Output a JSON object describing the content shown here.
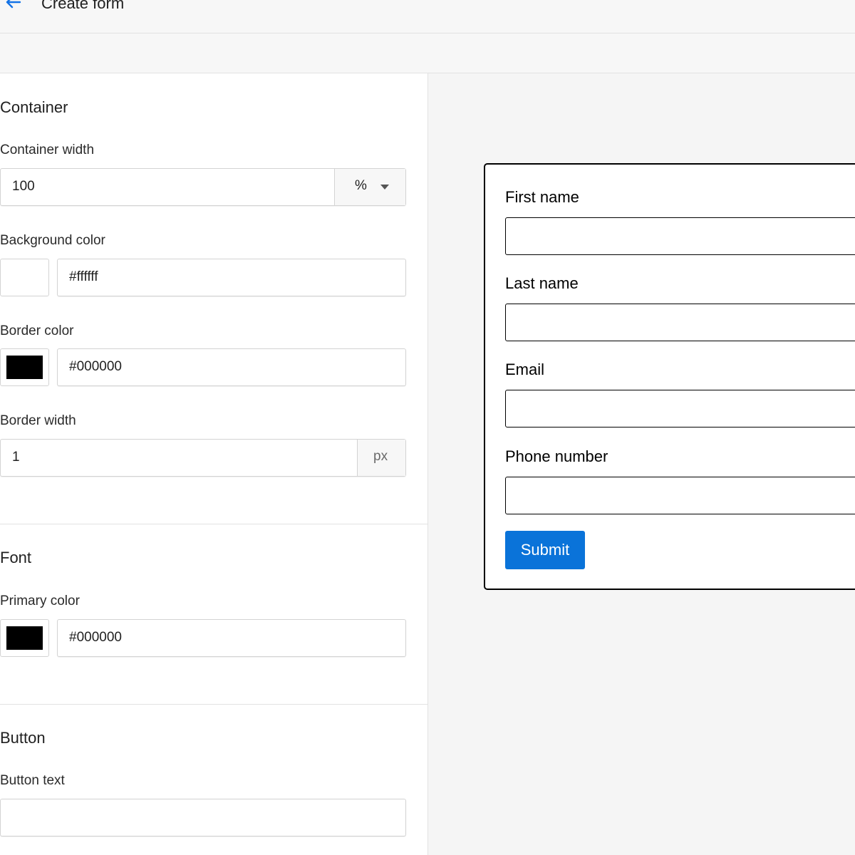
{
  "header": {
    "title": "Create form",
    "back_icon": "arrow-left-icon"
  },
  "container": {
    "title": "Container",
    "width_label": "Container width",
    "width_value": "100",
    "width_unit": "%",
    "bg_label": "Background color",
    "bg_value": "#ffffff",
    "bg_swatch": "#ffffff",
    "border_color_label": "Border color",
    "border_color_value": "#000000",
    "border_color_swatch": "#000000",
    "border_width_label": "Border width",
    "border_width_value": "1",
    "border_width_unit": "px"
  },
  "font": {
    "title": "Font",
    "primary_label": "Primary color",
    "primary_value": "#000000",
    "primary_swatch": "#000000"
  },
  "button": {
    "title": "Button",
    "text_label": "Button text",
    "text_value": ""
  },
  "preview": {
    "fields": [
      "First name",
      "Last name",
      "Email",
      "Phone number"
    ],
    "submit_label": "Submit",
    "submit_color": "#0a73d9",
    "border_color": "#000000"
  }
}
